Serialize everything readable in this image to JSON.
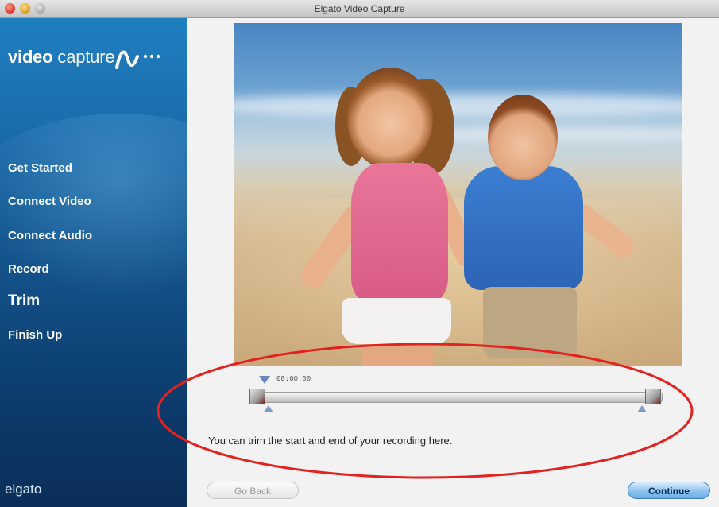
{
  "window": {
    "title": "Elgato Video Capture"
  },
  "sidebar": {
    "brand_bold": "video",
    "brand_light": "capture",
    "steps": [
      {
        "label": "Get Started"
      },
      {
        "label": "Connect Video"
      },
      {
        "label": "Connect Audio"
      },
      {
        "label": "Record"
      },
      {
        "label": "Trim",
        "active": true
      },
      {
        "label": "Finish Up"
      }
    ],
    "footer_logo": "elgato"
  },
  "trim": {
    "timecode": "00:00.00",
    "hint": "You can trim the start and end of your recording here."
  },
  "buttons": {
    "back": "Go Back",
    "continue": "Continue"
  },
  "colors": {
    "sidebar_top": "#1f7fc1",
    "sidebar_bottom": "#0a2f58",
    "annotation": "#e3211f",
    "continue_button": "#8fc3ee"
  }
}
